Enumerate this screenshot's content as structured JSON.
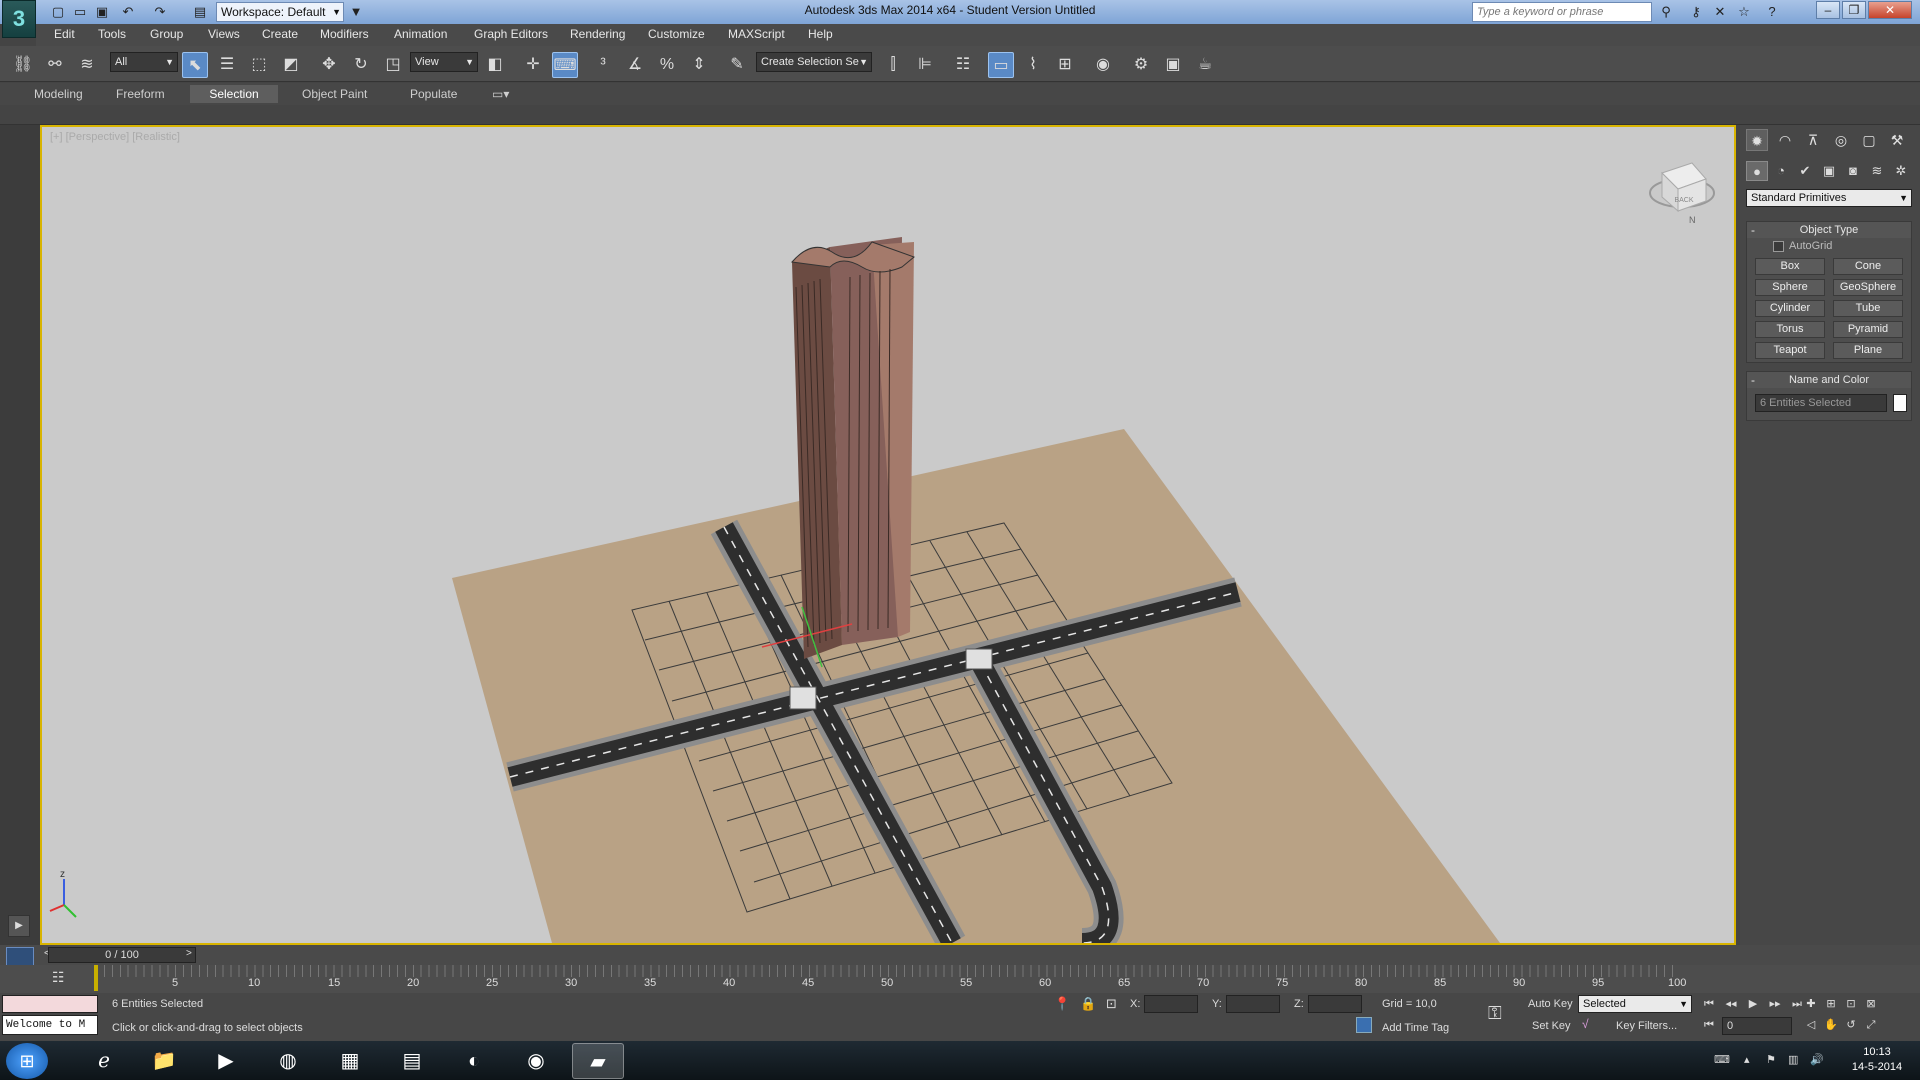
{
  "app": {
    "logo": "3",
    "title": "Autodesk 3ds Max  2014 x64  - Student Version    Untitled",
    "workspace": "Workspace: Default",
    "search_placeholder": "Type a keyword or phrase",
    "win_minimize": "–",
    "win_restore": "❐",
    "win_close": "✕"
  },
  "menu": [
    "Edit",
    "Tools",
    "Group",
    "Views",
    "Create",
    "Modifiers",
    "Animation",
    "Graph Editors",
    "Rendering",
    "Customize",
    "MAXScript",
    "Help"
  ],
  "toolbar": {
    "filter": "All",
    "ref_coord": "View",
    "selection_set": "Create Selection Se"
  },
  "ribbon_tabs": [
    "Modeling",
    "Freeform",
    "Selection",
    "Object Paint",
    "Populate"
  ],
  "ribbon_active": "Selection",
  "viewport": {
    "label": "[+] [Perspective] [Realistic]",
    "viewcube_face": "BACK",
    "compass_n": "N"
  },
  "command_panel": {
    "category": "Standard Primitives",
    "object_type_title": "Object Type",
    "autogrid": "AutoGrid",
    "buttons": [
      "Box",
      "Cone",
      "Sphere",
      "GeoSphere",
      "Cylinder",
      "Tube",
      "Torus",
      "Pyramid",
      "Teapot",
      "Plane"
    ],
    "name_color_title": "Name and Color",
    "name_value": "6 Entities Selected",
    "swatch_color": "#ffffff"
  },
  "timeline": {
    "slider": "0 / 100",
    "ticks": [
      "5",
      "10",
      "15",
      "20",
      "25",
      "30",
      "35",
      "40",
      "45",
      "50",
      "55",
      "60",
      "65",
      "70",
      "75",
      "80",
      "85",
      "90",
      "95",
      "100"
    ]
  },
  "status": {
    "welcome": "Welcome to M",
    "selected": "6 Entities Selected",
    "prompt": "Click or click-and-drag to select objects",
    "x_label": "X:",
    "y_label": "Y:",
    "z_label": "Z:",
    "grid": "Grid = 10,0",
    "add_time_tag": "Add Time Tag",
    "auto_key": "Auto Key",
    "set_key": "Set Key",
    "key_mode": "Selected",
    "key_filters": "Key Filters...",
    "frame": "0"
  },
  "taskbar": {
    "time": "10:13",
    "date": "14-5-2014"
  },
  "colors": {
    "viewport_bg": "#cacaca",
    "ground": "#b9a285",
    "road": "#2e2e2e",
    "building": "#a47a6b",
    "selection_border": "#d8b400"
  }
}
